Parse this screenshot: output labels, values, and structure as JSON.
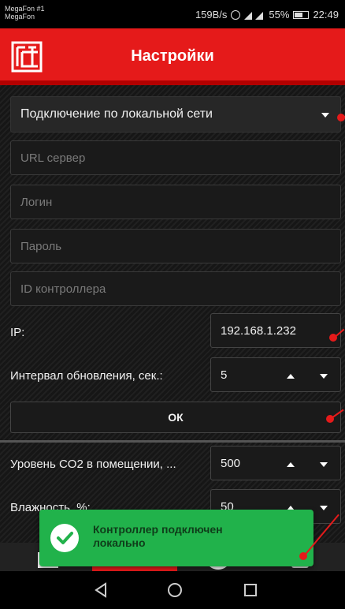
{
  "status_bar": {
    "carrier_1": "MegaFon #1",
    "carrier_2": "MegaFon",
    "net_speed": "159B/s",
    "battery": "55%",
    "time": "22:49"
  },
  "app_bar": {
    "title": "Настройки",
    "logo_icon": "gts-logo-icon"
  },
  "connection": {
    "selected": "Подключение по локальной сети"
  },
  "fields": {
    "url": {
      "placeholder": "URL сервер",
      "value": ""
    },
    "login": {
      "placeholder": "Логин",
      "value": ""
    },
    "password": {
      "placeholder": "Пароль",
      "value": ""
    },
    "controller_id": {
      "placeholder": "ID контроллера",
      "value": ""
    }
  },
  "ip": {
    "label": "IP:",
    "value": "192.168.1.232"
  },
  "interval": {
    "label": "Интервал обновления, сек.:",
    "value": "5"
  },
  "ok_button": {
    "label": "ОК"
  },
  "co2": {
    "label": "Уровень CO2 в помещении, ...",
    "value": "500"
  },
  "humidity": {
    "label": "Влажность, %:",
    "value": "50"
  },
  "toast": {
    "message": "Контроллер подключен локально",
    "icon": "check-icon"
  },
  "colors": {
    "accent": "#e51a1a",
    "toast": "#21b24b",
    "background": "#1c1c1c"
  }
}
